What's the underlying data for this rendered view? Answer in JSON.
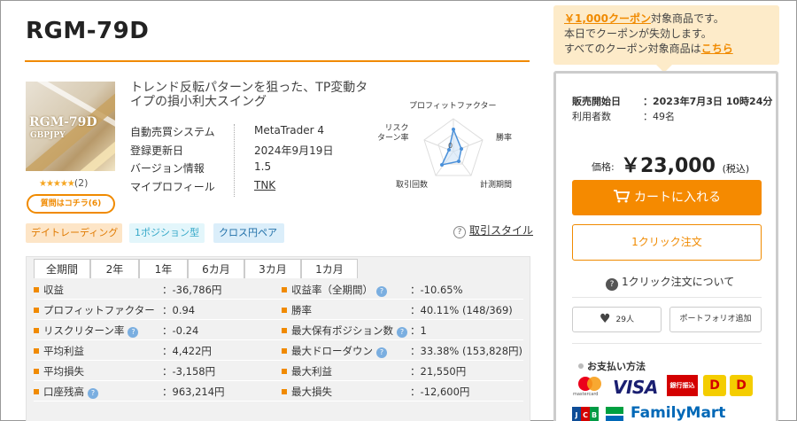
{
  "product": {
    "title": "RGM-79D",
    "thumb_title": "RGM-79D",
    "thumb_sub": "GBPJPY",
    "rating_stars": "★★★★★",
    "review_count": "(2)",
    "qa_button": "質問はコチラ(6)",
    "catch_copy": "トレンド反転パターンを狙った、TP変動タイプの損小利大スイング",
    "specs": [
      {
        "key": "自動売買システム",
        "value": "MetaTrader 4"
      },
      {
        "key": "登録更新日",
        "value": "2024年9月19日"
      },
      {
        "key": "バージョン情報",
        "value": "1.5"
      },
      {
        "key": "マイプロフィール",
        "value": "TNK"
      }
    ]
  },
  "radar": {
    "labels": {
      "profit_factor": "プロフィットファクター",
      "win_rate": "勝率",
      "period": "計測期間",
      "trades": "取引回数",
      "risk_return": "リスク\nターン率"
    },
    "axis_label": "0"
  },
  "tags": [
    "デイトレーディング",
    "1ポジション型",
    "クロス円ペア"
  ],
  "style_link": "取引スタイル",
  "tabs": [
    "全期間",
    "2年",
    "1年",
    "6カ月",
    "3カ月",
    "1カ月"
  ],
  "stats_left": [
    {
      "label": "収益",
      "value": "：-36,786円",
      "help": false
    },
    {
      "label": "プロフィットファクター",
      "value": "：0.94",
      "help": false
    },
    {
      "label": "リスクリターン率",
      "value": "：-0.24",
      "help": true
    },
    {
      "label": "平均利益",
      "value": "：4,422円",
      "help": false
    },
    {
      "label": "平均損失",
      "value": "：-3,158円",
      "help": false
    },
    {
      "label": "口座残高",
      "value": "：963,214円",
      "help": true
    }
  ],
  "stats_right": [
    {
      "label": "収益率（全期間）",
      "value": "：-10.65%",
      "help": true
    },
    {
      "label": "勝率",
      "value": "：40.11% (148/369)",
      "help": false
    },
    {
      "label": "最大保有ポジション数",
      "value": "：1",
      "help": true
    },
    {
      "label": "最大ドローダウン",
      "value": "：33.38% (153,828円)",
      "help": true
    },
    {
      "label": "最大利益",
      "value": "：21,550円",
      "help": false
    },
    {
      "label": "最大損失",
      "value": "：-12,600円",
      "help": false
    }
  ],
  "coupon": {
    "amount": "￥1,000クーポン",
    "line1_rest": "対象商品です。",
    "line2": "本日でクーポンが失効します。",
    "line3_pre": "すべてのクーポン対象商品は",
    "line3_link": "こちら"
  },
  "purchase": {
    "sale_start_label": "販売開始日",
    "sale_start_value": "：2023年7月3日 10時24分",
    "users_label": "利用者数",
    "users_value": "：49名",
    "price_label": "価格:",
    "price": "￥23,000",
    "tax": "(税込)",
    "cart_button": "カートに入れる",
    "oneclick_button": "1クリック注文",
    "oneclick_about": "1クリック注文について",
    "fav_count": "29人",
    "portfolio_button": "ポートフォリオ追加",
    "payment_title": "お支払い方法",
    "mastercard": "mastercard",
    "visa": "VISA",
    "bank": "銀行振込",
    "familymart": "FamilyMart"
  },
  "colors": {
    "accent": "#f08a00",
    "radar_line": "#4a90d9"
  }
}
